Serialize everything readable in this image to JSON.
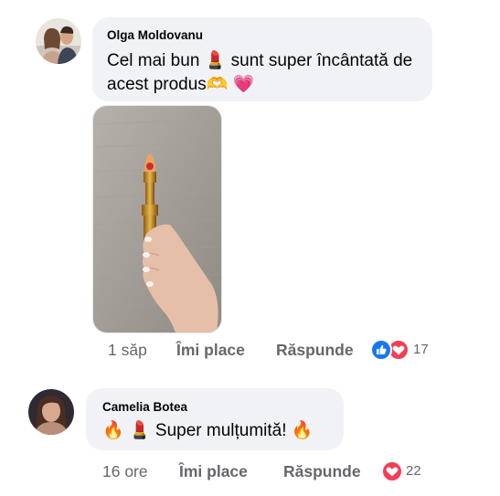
{
  "comments": [
    {
      "author": "Olga Moldovanu",
      "text_before": "Cel mai bun",
      "lipstick_emoji": "💄",
      "text_after": "sunt super încântată de",
      "text_line2": "acest produs",
      "heart_hands_emoji": "🫶",
      "heart_emoji": "💗",
      "time": "1 săp",
      "like_label": "Îmi place",
      "reply_label": "Răspunde",
      "reactions": [
        "like",
        "love"
      ],
      "reaction_count": "17"
    },
    {
      "author": "Camelia Botea",
      "fire_emoji": "🔥",
      "lipstick_emoji": "💄",
      "text": "Super mulțumită!",
      "time": "16 ore",
      "like_label": "Îmi place",
      "reply_label": "Răspunde",
      "reactions": [
        "love"
      ],
      "reaction_count": "22"
    }
  ],
  "colors": {
    "bubble": "#f0f2f5",
    "meta_text": "#65676b",
    "like_blue": "#1877f2",
    "love_red": "#f33e58"
  }
}
